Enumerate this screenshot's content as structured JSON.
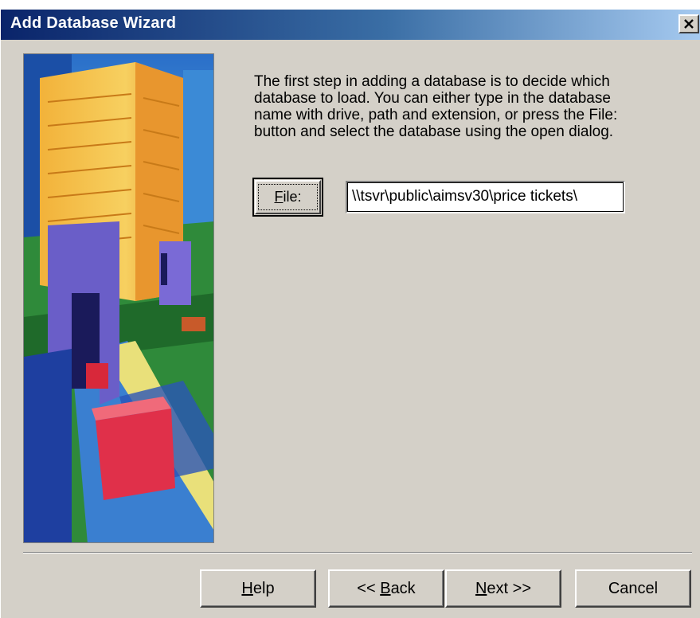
{
  "window": {
    "title": "Add Database Wizard",
    "close_glyph": "✕"
  },
  "instructions": {
    "line1": "The first step in adding a database is to decide which",
    "line2": "database to load.  You can either type in the database",
    "line3": "name with drive, path and extension, or press the File:",
    "line4": "button and select the database using the open dialog."
  },
  "file": {
    "button_label_mnemonic": "F",
    "button_label_rest": "ile:",
    "path_value": "\\\\tsvr\\public\\aimsv30\\price tickets\\"
  },
  "buttons": {
    "help_mnemonic": "H",
    "help_rest": "elp",
    "back_prefix": "<< ",
    "back_mnemonic": "B",
    "back_rest": "ack",
    "next_mnemonic": "N",
    "next_rest": "ext >>",
    "cancel": "Cancel"
  },
  "colors": {
    "dialog_face": "#d4d0c8",
    "title_gradient_start": "#0a246a",
    "title_gradient_end": "#a6caf0"
  },
  "icons": {
    "close": "close-icon",
    "side_art": "wizard-illustration-buildings"
  }
}
